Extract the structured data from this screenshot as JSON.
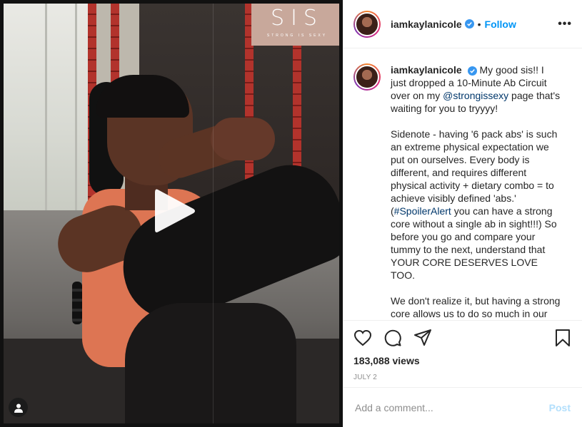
{
  "video": {
    "logo_big": "SIS",
    "logo_small": "STRONG IS SEXY",
    "play_icon": "play-icon",
    "user_tag_icon": "user-icon"
  },
  "header": {
    "username": "iamkaylanicole",
    "separator": "•",
    "follow_label": "Follow",
    "more_label": "•••"
  },
  "caption": {
    "username": "iamkaylanicole",
    "p1_before": "My good sis!! I just dropped a 10-Minute Ab Circuit over on my ",
    "p1_mention": "@strongissexy",
    "p1_after": " page that's waiting for you to tryyyy!",
    "p2_before": "Sidenote - having '6 pack abs' is such an extreme physical expectation we put on ourselves. Every body is different, and requires different physical activity + dietary combo = to achieve visibly defined 'abs.' (",
    "p2_hashtag": "#SpoilerAlert",
    "p2_after": " you can have a strong core without a single ab in sight!!!) So before you go and compare your tummy to the next, understand that YOUR CORE DESERVES LOVE TOO.",
    "p3": "We don't realize it, but having a strong core allows us to do so much in our everyday lives. Core exercises train"
  },
  "stats": {
    "views": "183,088 views",
    "date": "JULY 2"
  },
  "comment": {
    "placeholder": "Add a comment...",
    "post_label": "Post"
  },
  "colors": {
    "link": "#0095f6",
    "mention": "#00376b",
    "post_disabled": "#b2dffc",
    "logo_bg": "#c8a89b"
  }
}
